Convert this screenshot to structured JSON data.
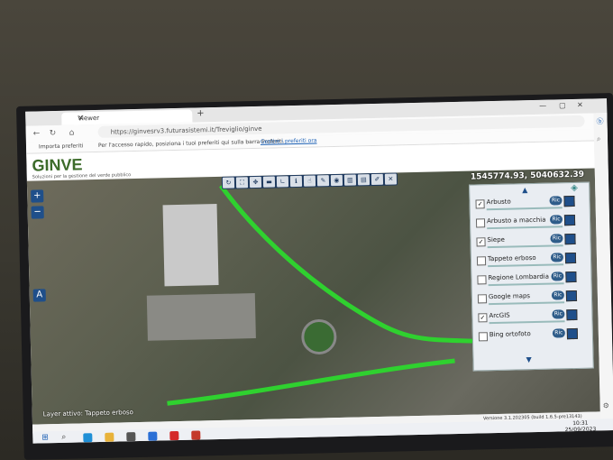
{
  "browser": {
    "tab_title": "Viewer",
    "tab_close": "✕",
    "new_tab": "+",
    "url": "https://ginvesrv3.futurasistemi.it/Treviglio/ginve",
    "import_favorites": "Importa preferiti",
    "favorites_prompt": "Per l'accesso rapido, posiziona i tuoi preferiti qui sulla barra Preferiti.",
    "manage_favorites": "Gestire i preferiti ora"
  },
  "app": {
    "logo_text": "GINVE",
    "logo_subtitle": "Soluzioni per la gestione del verde pubblico",
    "coordinates": "1545774.93, 5040632.39",
    "active_layer": "Layer attivo: Tappeto erboso",
    "version": "Versione 3.1.202305 (build 1.6.5-pre13143)"
  },
  "layers_panel": {
    "items": [
      {
        "label": "Arbusto",
        "checked": true
      },
      {
        "label": "Arbusto a macchia",
        "checked": false
      },
      {
        "label": "Siepe",
        "checked": true
      },
      {
        "label": "Tappeto erboso",
        "checked": false
      },
      {
        "label": "Regione Lombardia",
        "checked": false
      },
      {
        "label": "Google maps",
        "checked": false
      },
      {
        "label": "ArcGIS",
        "checked": true
      },
      {
        "label": "Bing ortofoto",
        "checked": false
      }
    ],
    "ric_label": "Ric"
  },
  "taskbar": {
    "time": "10:31",
    "date": "25/09/2023"
  }
}
